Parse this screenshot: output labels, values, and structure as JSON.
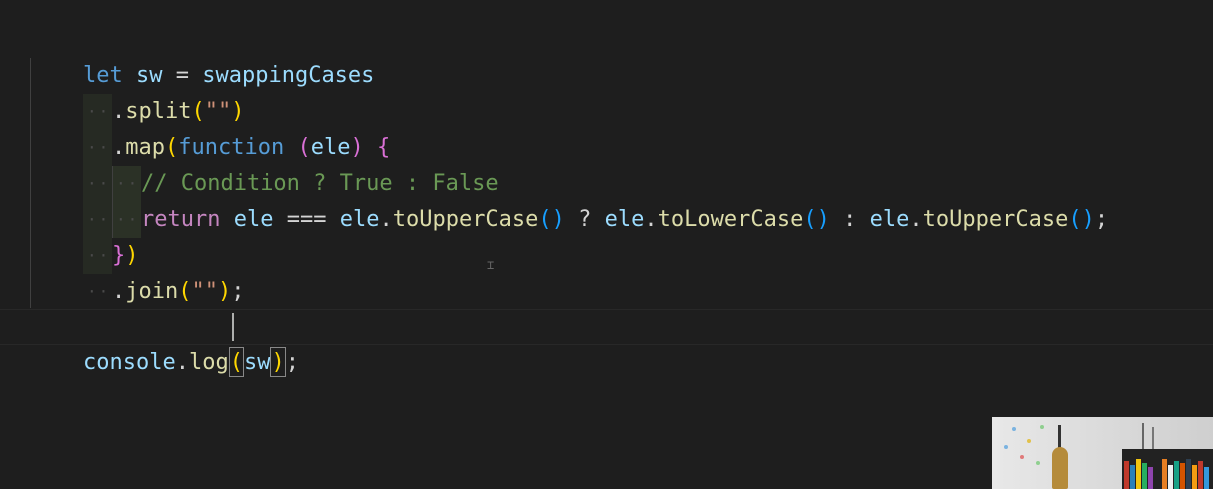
{
  "editor": {
    "line1": {
      "kw_let": "let",
      "var_sw": "sw",
      "op_eq": "=",
      "var_source": "swappingCases"
    },
    "line2": {
      "dot": ".",
      "fn": "split",
      "open": "(",
      "str": "\"\"",
      "close": ")"
    },
    "line3": {
      "dot": ".",
      "fn": "map",
      "open": "(",
      "kw_function": "function",
      "param_open": "(",
      "param": "ele",
      "param_close": ")",
      "brace": "{"
    },
    "line4": {
      "comment": "// Condition ? True : False"
    },
    "line5": {
      "kw_return": "return",
      "ele1": "ele",
      "op_eq3": "===",
      "ele2": "ele",
      "dot1": ".",
      "fn1": "toUpperCase",
      "call1": "()",
      "q": "?",
      "ele3": "ele",
      "dot2": ".",
      "fn2": "toLowerCase",
      "call2": "()",
      "colon": ":",
      "ele4": "ele",
      "dot3": ".",
      "fn3": "toUpperCase",
      "call3": "()",
      "semi": ";"
    },
    "line6": {
      "brace": "}",
      "close": ")"
    },
    "line7": {
      "dot": ".",
      "fn": "join",
      "open": "(",
      "str": "\"\"",
      "close": ")",
      "semi": ";"
    },
    "line9": {
      "obj": "console",
      "dot": ".",
      "fn": "log",
      "open": "(",
      "arg": "sw",
      "close": ")",
      "semi": ";"
    },
    "indent_dots": "··"
  },
  "colors": {
    "background": "#1e1e1e",
    "keyword": "#569cd6",
    "variable": "#9cdcfe",
    "function": "#dcdcaa",
    "string": "#ce9178",
    "comment": "#6a9955",
    "bracket_level1": "#ffd700",
    "bracket_level2": "#da70d6"
  },
  "webcam": {
    "description_icon": "webcam-overlay"
  }
}
